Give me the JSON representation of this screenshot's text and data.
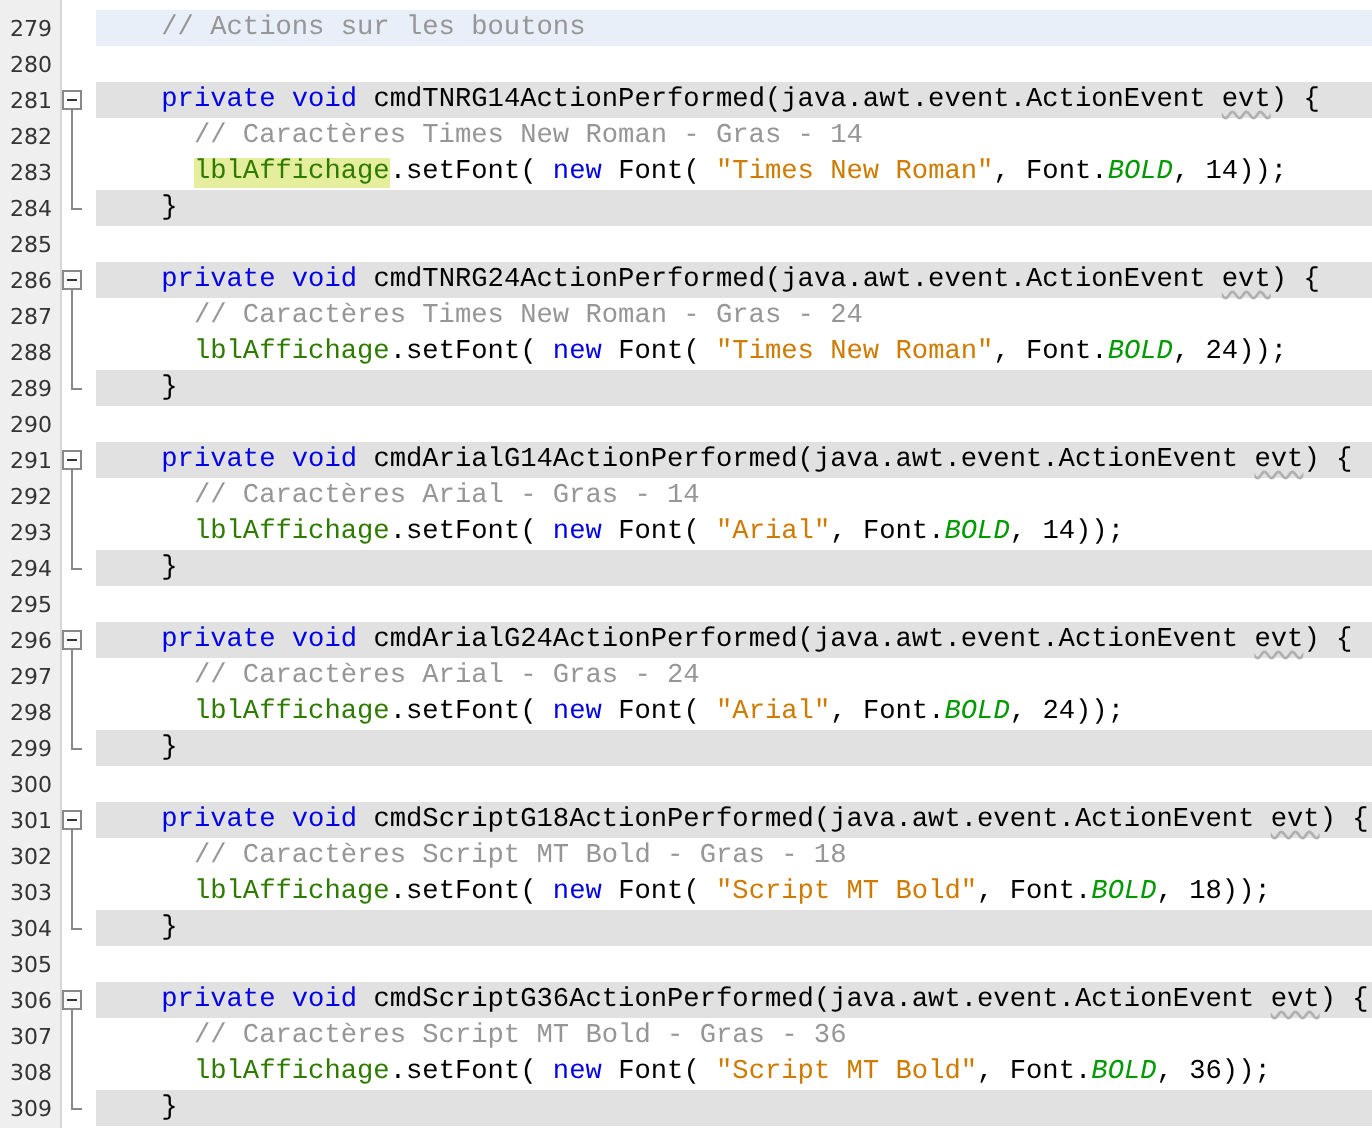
{
  "editor": {
    "lines": [
      {
        "number": "279",
        "kind": "section",
        "highlighted": false,
        "current": true,
        "tokens": [
          {
            "kind": "comment",
            "text": "// Actions sur les boutons"
          }
        ]
      },
      {
        "number": "280",
        "kind": "blank",
        "highlighted": false,
        "current": false
      },
      {
        "number": "281",
        "kind": "header",
        "highlighted": true,
        "current": false,
        "expanded": true,
        "tokens": [
          {
            "kind": "keyword",
            "text": "private void"
          },
          {
            "kind": "plain",
            "text": " cmdTNRG14ActionPerformed(java.awt.event.ActionEvent "
          },
          {
            "kind": "warned",
            "text": "evt"
          },
          {
            "kind": "plain",
            "text": ") {"
          }
        ],
        "children": [
          {
            "number": "282",
            "kind": "body",
            "highlighted": false,
            "current": false,
            "tokens": [
              {
                "kind": "comment",
                "text": "// Caractères Times New Roman - Gras - 14"
              }
            ]
          },
          {
            "number": "283",
            "kind": "body",
            "highlighted": false,
            "current": false,
            "tokens": [
              {
                "kind": "field-marked",
                "text": "lblAffichage"
              },
              {
                "kind": "plain",
                "text": ".setFont( "
              },
              {
                "kind": "keyword",
                "text": "new"
              },
              {
                "kind": "plain",
                "text": " Font( "
              },
              {
                "kind": "string",
                "text": "\"Times New Roman\""
              },
              {
                "kind": "plain",
                "text": ", Font."
              },
              {
                "kind": "constant",
                "text": "BOLD"
              },
              {
                "kind": "plain",
                "text": ", 14));"
              }
            ]
          },
          {
            "number": "284",
            "kind": "brace",
            "highlighted": true,
            "current": false,
            "tokens": [
              {
                "kind": "plain",
                "text": "}"
              }
            ]
          }
        ]
      },
      {
        "number": "285",
        "kind": "blank",
        "highlighted": false,
        "current": false
      },
      {
        "number": "286",
        "kind": "header",
        "highlighted": true,
        "current": false,
        "expanded": true,
        "tokens": [
          {
            "kind": "keyword",
            "text": "private void"
          },
          {
            "kind": "plain",
            "text": " cmdTNRG24ActionPerformed(java.awt.event.ActionEvent "
          },
          {
            "kind": "warned",
            "text": "evt"
          },
          {
            "kind": "plain",
            "text": ") {"
          }
        ],
        "children": [
          {
            "number": "287",
            "kind": "body",
            "highlighted": false,
            "current": false,
            "tokens": [
              {
                "kind": "comment",
                "text": "// Caractères Times New Roman - Gras - 24"
              }
            ]
          },
          {
            "number": "288",
            "kind": "body",
            "highlighted": false,
            "current": false,
            "tokens": [
              {
                "kind": "field",
                "text": "lblAffichage"
              },
              {
                "kind": "plain",
                "text": ".setFont( "
              },
              {
                "kind": "keyword",
                "text": "new"
              },
              {
                "kind": "plain",
                "text": " Font( "
              },
              {
                "kind": "string",
                "text": "\"Times New Roman\""
              },
              {
                "kind": "plain",
                "text": ", Font."
              },
              {
                "kind": "constant",
                "text": "BOLD"
              },
              {
                "kind": "plain",
                "text": ", 24));"
              }
            ]
          },
          {
            "number": "289",
            "kind": "brace",
            "highlighted": true,
            "current": false,
            "tokens": [
              {
                "kind": "plain",
                "text": "}"
              }
            ]
          }
        ]
      },
      {
        "number": "290",
        "kind": "blank",
        "highlighted": false,
        "current": false
      },
      {
        "number": "291",
        "kind": "header",
        "highlighted": true,
        "current": false,
        "expanded": true,
        "tokens": [
          {
            "kind": "keyword",
            "text": "private void"
          },
          {
            "kind": "plain",
            "text": " cmdArialG14ActionPerformed(java.awt.event.ActionEvent "
          },
          {
            "kind": "warned",
            "text": "evt"
          },
          {
            "kind": "plain",
            "text": ") {"
          }
        ],
        "children": [
          {
            "number": "292",
            "kind": "body",
            "highlighted": false,
            "current": false,
            "tokens": [
              {
                "kind": "comment",
                "text": "// Caractères Arial - Gras - 14"
              }
            ]
          },
          {
            "number": "293",
            "kind": "body",
            "highlighted": false,
            "current": false,
            "tokens": [
              {
                "kind": "field",
                "text": "lblAffichage"
              },
              {
                "kind": "plain",
                "text": ".setFont( "
              },
              {
                "kind": "keyword",
                "text": "new"
              },
              {
                "kind": "plain",
                "text": " Font( "
              },
              {
                "kind": "string",
                "text": "\"Arial\""
              },
              {
                "kind": "plain",
                "text": ", Font."
              },
              {
                "kind": "constant",
                "text": "BOLD"
              },
              {
                "kind": "plain",
                "text": ", 14));"
              }
            ]
          },
          {
            "number": "294",
            "kind": "brace",
            "highlighted": true,
            "current": false,
            "tokens": [
              {
                "kind": "plain",
                "text": "}"
              }
            ]
          }
        ]
      },
      {
        "number": "295",
        "kind": "blank",
        "highlighted": false,
        "current": false
      },
      {
        "number": "296",
        "kind": "header",
        "highlighted": true,
        "current": false,
        "expanded": true,
        "tokens": [
          {
            "kind": "keyword",
            "text": "private void"
          },
          {
            "kind": "plain",
            "text": " cmdArialG24ActionPerformed(java.awt.event.ActionEvent "
          },
          {
            "kind": "warned",
            "text": "evt"
          },
          {
            "kind": "plain",
            "text": ") {"
          }
        ],
        "children": [
          {
            "number": "297",
            "kind": "body",
            "highlighted": false,
            "current": false,
            "tokens": [
              {
                "kind": "comment",
                "text": "// Caractères Arial - Gras - 24"
              }
            ]
          },
          {
            "number": "298",
            "kind": "body",
            "highlighted": false,
            "current": false,
            "tokens": [
              {
                "kind": "field",
                "text": "lblAffichage"
              },
              {
                "kind": "plain",
                "text": ".setFont( "
              },
              {
                "kind": "keyword",
                "text": "new"
              },
              {
                "kind": "plain",
                "text": " Font( "
              },
              {
                "kind": "string",
                "text": "\"Arial\""
              },
              {
                "kind": "plain",
                "text": ", Font."
              },
              {
                "kind": "constant",
                "text": "BOLD"
              },
              {
                "kind": "plain",
                "text": ", 24));"
              }
            ]
          },
          {
            "number": "299",
            "kind": "brace",
            "highlighted": true,
            "current": false,
            "tokens": [
              {
                "kind": "plain",
                "text": "}"
              }
            ]
          }
        ]
      },
      {
        "number": "300",
        "kind": "blank",
        "highlighted": false,
        "current": false
      },
      {
        "number": "301",
        "kind": "header",
        "highlighted": true,
        "current": false,
        "expanded": true,
        "tokens": [
          {
            "kind": "keyword",
            "text": "private void"
          },
          {
            "kind": "plain",
            "text": " cmdScriptG18ActionPerformed(java.awt.event.ActionEvent "
          },
          {
            "kind": "warned",
            "text": "evt"
          },
          {
            "kind": "plain",
            "text": ") {"
          }
        ],
        "children": [
          {
            "number": "302",
            "kind": "body",
            "highlighted": false,
            "current": false,
            "tokens": [
              {
                "kind": "comment",
                "text": "// Caractères Script MT Bold - Gras - 18"
              }
            ]
          },
          {
            "number": "303",
            "kind": "body",
            "highlighted": false,
            "current": false,
            "tokens": [
              {
                "kind": "field",
                "text": "lblAffichage"
              },
              {
                "kind": "plain",
                "text": ".setFont( "
              },
              {
                "kind": "keyword",
                "text": "new"
              },
              {
                "kind": "plain",
                "text": " Font( "
              },
              {
                "kind": "string",
                "text": "\"Script MT Bold\""
              },
              {
                "kind": "plain",
                "text": ", Font."
              },
              {
                "kind": "constant",
                "text": "BOLD"
              },
              {
                "kind": "plain",
                "text": ", 18));"
              }
            ]
          },
          {
            "number": "304",
            "kind": "brace",
            "highlighted": true,
            "current": false,
            "tokens": [
              {
                "kind": "plain",
                "text": "}"
              }
            ]
          }
        ]
      },
      {
        "number": "305",
        "kind": "blank",
        "highlighted": false,
        "current": false
      },
      {
        "number": "306",
        "kind": "header",
        "highlighted": true,
        "current": false,
        "expanded": true,
        "tokens": [
          {
            "kind": "keyword",
            "text": "private void"
          },
          {
            "kind": "plain",
            "text": " cmdScriptG36ActionPerformed(java.awt.event.ActionEvent "
          },
          {
            "kind": "warned",
            "text": "evt"
          },
          {
            "kind": "plain",
            "text": ") {"
          }
        ],
        "children": [
          {
            "number": "307",
            "kind": "body",
            "highlighted": false,
            "current": false,
            "tokens": [
              {
                "kind": "comment",
                "text": "// Caractères Script MT Bold - Gras - 36"
              }
            ]
          },
          {
            "number": "308",
            "kind": "body",
            "highlighted": false,
            "current": false,
            "tokens": [
              {
                "kind": "field",
                "text": "lblAffichage"
              },
              {
                "kind": "plain",
                "text": ".setFont( "
              },
              {
                "kind": "keyword",
                "text": "new"
              },
              {
                "kind": "plain",
                "text": " Font( "
              },
              {
                "kind": "string",
                "text": "\"Script MT Bold\""
              },
              {
                "kind": "plain",
                "text": ", Font."
              },
              {
                "kind": "constant",
                "text": "BOLD"
              },
              {
                "kind": "plain",
                "text": ", 36));"
              }
            ]
          },
          {
            "number": "309",
            "kind": "brace",
            "highlighted": true,
            "current": false,
            "tokens": [
              {
                "kind": "plain",
                "text": "}"
              }
            ]
          }
        ]
      }
    ]
  }
}
